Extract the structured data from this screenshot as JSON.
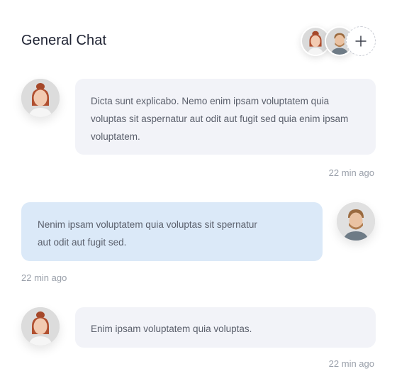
{
  "header": {
    "title": "General Chat",
    "participants": [
      "participant-woman",
      "participant-man"
    ],
    "add_icon": "plus-icon"
  },
  "messages": [
    {
      "direction": "incoming",
      "avatar": "woman-avatar",
      "text": "Dicta sunt explicabo. Nemo enim ipsam voluptatem quia voluptas sit aspernatur aut odit aut fugit sed quia enim ipsam voluptatem.",
      "time": "22 min ago"
    },
    {
      "direction": "outgoing",
      "avatar": "man-avatar",
      "text": "Nenim ipsam voluptatem quia voluptas sit spernatur aut odit aut fugit sed.",
      "time": "22 min ago"
    },
    {
      "direction": "incoming",
      "avatar": "woman-avatar",
      "text": "Enim ipsam voluptatem quia voluptas.",
      "time": "22 min ago"
    }
  ],
  "colors": {
    "incoming_bubble": "#f2f3f8",
    "outgoing_bubble": "#dbe9f8",
    "timestamp": "#9aa0aa"
  }
}
